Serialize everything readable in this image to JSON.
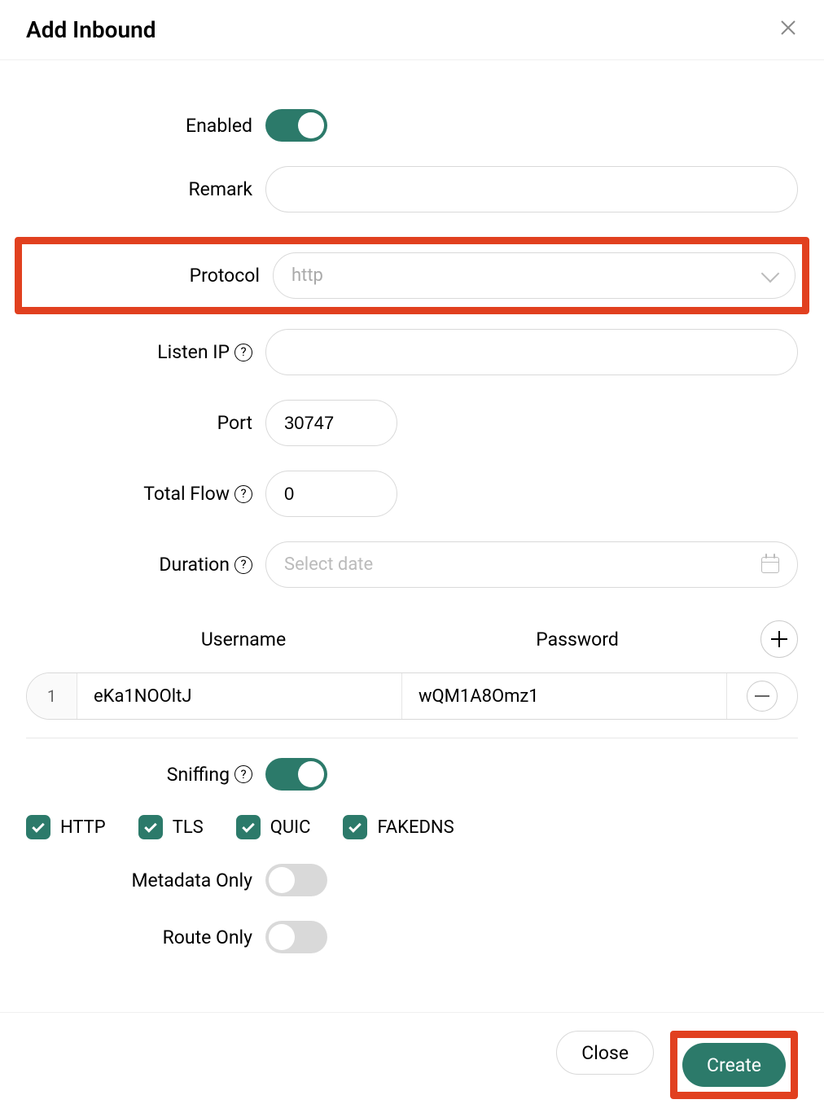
{
  "header": {
    "title": "Add Inbound"
  },
  "form": {
    "enabled": {
      "label": "Enabled",
      "on": true
    },
    "remark": {
      "label": "Remark",
      "value": ""
    },
    "protocol": {
      "label": "Protocol",
      "value": "http"
    },
    "listen_ip": {
      "label": "Listen IP",
      "value": ""
    },
    "port": {
      "label": "Port",
      "value": "30747"
    },
    "total_flow": {
      "label": "Total Flow",
      "value": "0"
    },
    "duration": {
      "label": "Duration",
      "placeholder": "Select date",
      "value": ""
    }
  },
  "creds": {
    "username_label": "Username",
    "password_label": "Password",
    "rows": [
      {
        "index": "1",
        "username": "eKa1NOOltJ",
        "password": "wQM1A8Omz1"
      }
    ]
  },
  "sniffing": {
    "label": "Sniffing",
    "on": true,
    "protocols": [
      {
        "name": "HTTP",
        "checked": true
      },
      {
        "name": "TLS",
        "checked": true
      },
      {
        "name": "QUIC",
        "checked": true
      },
      {
        "name": "FAKEDNS",
        "checked": true
      }
    ],
    "metadata_only": {
      "label": "Metadata Only",
      "on": false
    },
    "route_only": {
      "label": "Route Only",
      "on": false
    }
  },
  "footer": {
    "close": "Close",
    "create": "Create"
  }
}
